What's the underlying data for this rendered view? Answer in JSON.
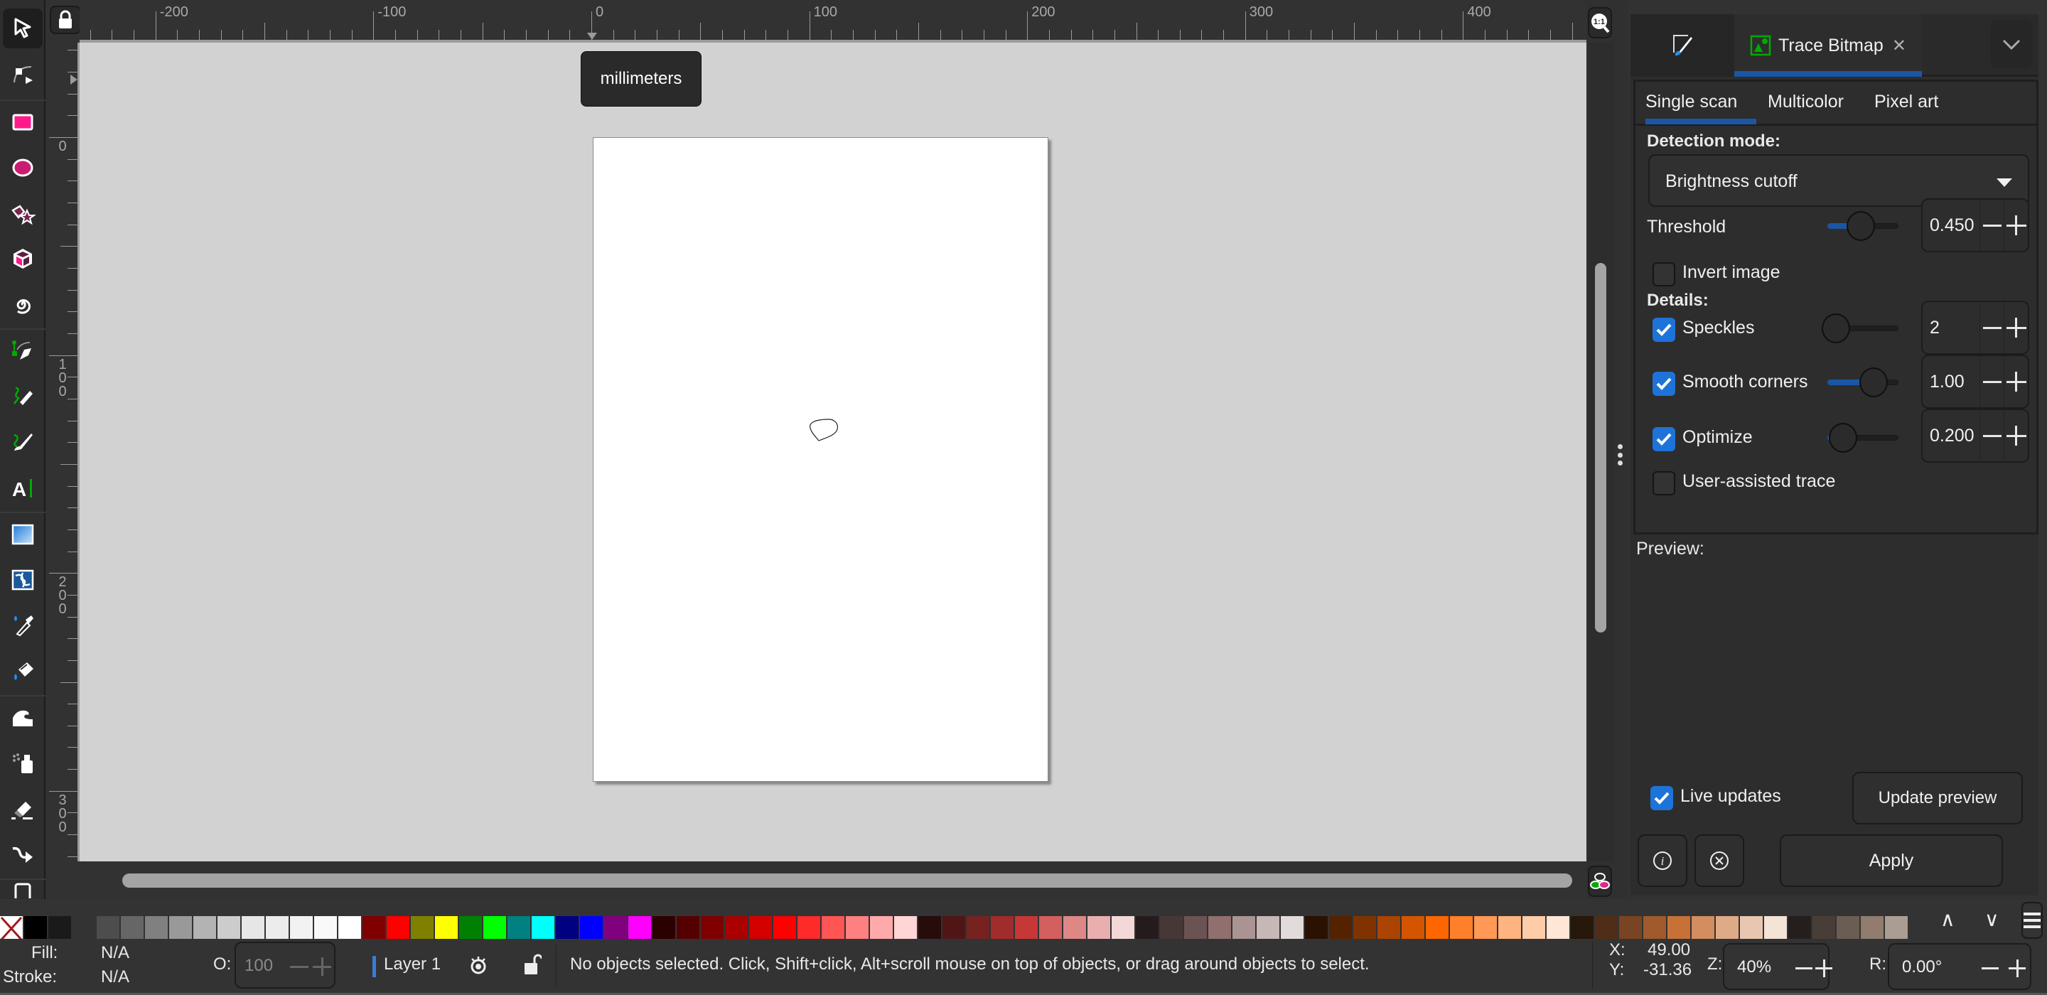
{
  "toolbox": {
    "tools": [
      {
        "name": "selector-tool",
        "icon": "arrow-cursor-icon",
        "active": true
      },
      {
        "name": "node-tool",
        "icon": "node-edit-icon"
      },
      {
        "name": "rectangle-tool",
        "icon": "rectangle-icon"
      },
      {
        "name": "ellipse-tool",
        "icon": "ellipse-icon"
      },
      {
        "name": "star-polygon-tool",
        "icon": "star-polygon-icon"
      },
      {
        "name": "3d-box-tool",
        "icon": "cube-icon"
      },
      {
        "name": "spiral-tool",
        "icon": "spiral-icon"
      },
      {
        "name": "pen-tool",
        "icon": "pen-bezier-icon"
      },
      {
        "name": "pencil-tool",
        "icon": "pencil-icon"
      },
      {
        "name": "calligraphy-tool",
        "icon": "calligraphy-brush-icon"
      },
      {
        "name": "text-tool",
        "icon": "text-icon"
      },
      {
        "name": "gradient-tool",
        "icon": "gradient-icon"
      },
      {
        "name": "mesh-tool",
        "icon": "mesh-icon"
      },
      {
        "name": "dropper-tool",
        "icon": "eyedropper-icon"
      },
      {
        "name": "paint-bucket-tool",
        "icon": "paint-bucket-icon"
      },
      {
        "name": "tweak-tool",
        "icon": "tweak-wave-icon"
      },
      {
        "name": "spray-tool",
        "icon": "spray-can-icon"
      },
      {
        "name": "eraser-tool",
        "icon": "eraser-icon"
      },
      {
        "name": "connector-tool",
        "icon": "connector-icon"
      },
      {
        "name": "pages-tool",
        "icon": "pages-icon"
      }
    ]
  },
  "rulers": {
    "unit_tooltip": "millimeters",
    "horizontal_labels": [
      "-200",
      "-100",
      "0",
      "100",
      "200",
      "300",
      "400"
    ],
    "vertical_labels": [
      "0",
      "100",
      "200",
      "300"
    ]
  },
  "canvas": {
    "zoom_1to1_label": "1:1"
  },
  "dock": {
    "tabs": [
      {
        "label": "Fill and Stroke",
        "icon": "fill-stroke-brush-icon"
      },
      {
        "label": "Trace Bitmap",
        "icon": "trace-bitmap-icon",
        "active": true
      }
    ],
    "trace": {
      "mode_tabs": [
        "Single scan",
        "Multicolor",
        "Pixel art"
      ],
      "active_mode_tab": "Single scan",
      "detection_mode_label": "Detection mode:",
      "detection_mode_value": "Brightness cutoff",
      "threshold": {
        "label": "Threshold",
        "value": "0.450",
        "slider_fraction": 0.45
      },
      "invert_image": {
        "label": "Invert image",
        "checked": false
      },
      "details_label": "Details:",
      "speckles": {
        "label": "Speckles",
        "checked": true,
        "value": "2",
        "slider_fraction": 0.0
      },
      "smooth_corners": {
        "label": "Smooth corners",
        "checked": true,
        "value": "1.00",
        "slider_fraction": 0.75
      },
      "optimize": {
        "label": "Optimize",
        "checked": true,
        "value": "0.200",
        "slider_fraction": 0.04
      },
      "user_assisted": {
        "label": "User-assisted trace",
        "checked": false
      },
      "preview_label": "Preview:",
      "live_updates": {
        "label": "Live updates",
        "checked": true
      },
      "update_preview_label": "Update preview",
      "apply_label": "Apply"
    }
  },
  "palette": {
    "none_swatch": "none",
    "colors": [
      "#000000",
      "#1a1a1a",
      "#333333",
      "#4d4d4d",
      "#666666",
      "#808080",
      "#999999",
      "#b3b3b3",
      "#cccccc",
      "#e6e6e6",
      "#ececec",
      "#f2f2f2",
      "#f9f9f9",
      "#ffffff",
      "#800000",
      "#ff0000",
      "#808000",
      "#ffff00",
      "#008000",
      "#00ff00",
      "#008080",
      "#00ffff",
      "#000080",
      "#0000ff",
      "#800080",
      "#ff00ff",
      "#2b0000",
      "#550000",
      "#800000",
      "#aa0000",
      "#d40000",
      "#ff0000",
      "#ff2a2a",
      "#ff5555",
      "#ff8080",
      "#ffaaaa",
      "#ffd5d5",
      "#280b0b",
      "#501616",
      "#782121",
      "#a02c2c",
      "#c83737",
      "#d35f5f",
      "#de8787",
      "#e9afaf",
      "#f4d7d7",
      "#241c1c",
      "#483737",
      "#6c5353",
      "#916f6f",
      "#ac9393",
      "#c8b7b7",
      "#e3dbdb",
      "#2b1100",
      "#552200",
      "#803300",
      "#aa4400",
      "#d45500",
      "#ff6600",
      "#ff7f2a",
      "#ff9955",
      "#ffb380",
      "#ffccaa",
      "#ffe6d5",
      "#28170b",
      "#502d16",
      "#784421",
      "#a05a2c",
      "#c87137",
      "#d38d5f",
      "#deaa87",
      "#e9c6af",
      "#f4e3d7",
      "#241f1c",
      "#483e37",
      "#6c5d53",
      "#917c6f",
      "#ac9d93"
    ]
  },
  "statusbar": {
    "fill_label": "Fill:",
    "fill_value": "N/A",
    "stroke_label": "Stroke:",
    "stroke_value": "N/A",
    "opacity_label": "O:",
    "opacity_value": "100",
    "layer_name": "Layer 1",
    "message": "No objects selected. Click, Shift+click, Alt+scroll mouse on top of objects, or drag around objects to select.",
    "x_label": "X:",
    "x_value": "49.00",
    "y_label": "Y:",
    "y_value": "-31.36",
    "zoom_label": "Z:",
    "zoom_value": "40%",
    "rotation_label": "R:",
    "rotation_value": "0.00°"
  }
}
